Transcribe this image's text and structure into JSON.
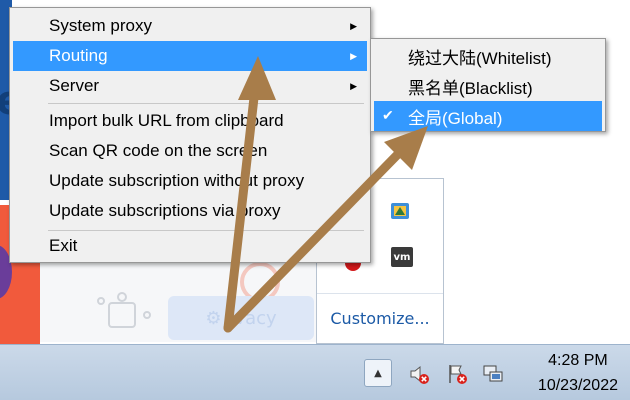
{
  "background": {
    "partial_letter": "e",
    "privacy_button_label": "ivacy"
  },
  "main_menu": {
    "items": [
      {
        "label": "System proxy",
        "submenu": true,
        "selected": false
      },
      {
        "label": "Routing",
        "submenu": true,
        "selected": true
      },
      {
        "label": "Server",
        "submenu": true,
        "selected": false
      },
      {
        "label": "Import bulk URL from clipboard",
        "submenu": false,
        "selected": false
      },
      {
        "label": "Scan QR code on the screen",
        "submenu": false,
        "selected": false
      },
      {
        "label": "Update subscription without proxy",
        "submenu": false,
        "selected": false
      },
      {
        "label": "Update subscriptions via proxy",
        "submenu": false,
        "selected": false
      },
      {
        "label": "Exit",
        "submenu": false,
        "selected": false
      }
    ]
  },
  "routing_submenu": {
    "items": [
      {
        "label": "绕过大陆(Whitelist)",
        "checked": false
      },
      {
        "label": "黑名单(Blacklist)",
        "checked": false
      },
      {
        "label": "全局(Global)",
        "checked": true
      }
    ]
  },
  "tray_popup": {
    "customize_label": "Customize...",
    "icons": [
      "app-icon",
      "vm-icon"
    ],
    "vm_label": "vm"
  },
  "taskbar": {
    "time": "4:28 PM",
    "date": "10/23/2022",
    "tray_icons": [
      "speaker-muted-icon",
      "action-center-flag-icon",
      "network-icon"
    ]
  },
  "colors": {
    "menu_highlight": "#3399ff",
    "arrow": "#a87d4a",
    "link": "#1c5aa6"
  }
}
